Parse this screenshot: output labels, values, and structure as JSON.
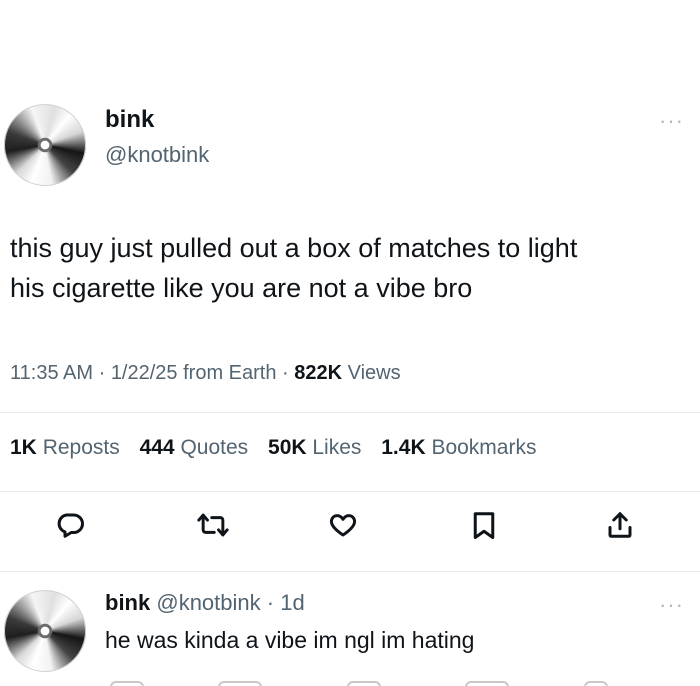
{
  "post": {
    "author": {
      "name": "bink",
      "handle": "@knotbink",
      "avatar_icon": "cd-disc-icon"
    },
    "more_icon": "···",
    "text_line_1": "this guy just pulled out a box of matches to light",
    "text_line_2": "his cigarette like you are not a vibe bro",
    "meta": {
      "time": "11:35 AM",
      "sep1": " · ",
      "date": "1/22/25",
      "source": " from Earth",
      "sep2": " · ",
      "views_count": "822K",
      "views_label": " Views"
    },
    "stats": [
      {
        "count": "1K",
        "label": " Reposts"
      },
      {
        "count": "444",
        "label": " Quotes"
      },
      {
        "count": "50K",
        "label": " Likes"
      },
      {
        "count": "1.4K",
        "label": " Bookmarks"
      }
    ],
    "actions": [
      "reply-icon",
      "repost-icon",
      "like-icon",
      "bookmark-icon",
      "share-icon"
    ]
  },
  "reply": {
    "author": {
      "name": "bink",
      "handle": "@knotbink",
      "avatar_icon": "cd-disc-icon"
    },
    "sep": " · ",
    "age": "1d",
    "text": "he was kinda a vibe im ngl im hating"
  },
  "colors": {
    "text": "#0f1419",
    "secondary": "#536471",
    "divider": "#e6ecf0"
  }
}
